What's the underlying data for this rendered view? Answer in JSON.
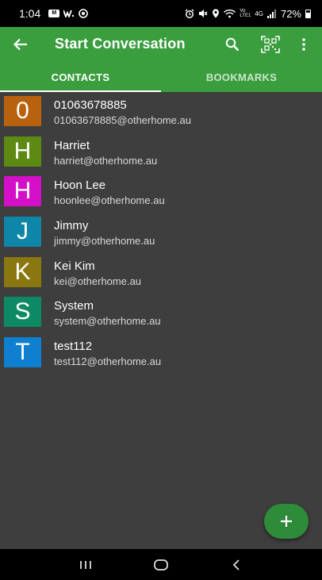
{
  "status_bar": {
    "time": "1:04",
    "left_icons": [
      "gmail-icon",
      "w-app-icon",
      "camera-icon"
    ],
    "right_icons": [
      "alarm-icon",
      "mute-icon",
      "location-icon",
      "wifi-icon",
      "volte-icon",
      "4g-icon",
      "signal-icon",
      "battery-icon"
    ],
    "network_4g": "4G",
    "volte_top": "Vo",
    "volte_bottom": "LTE1",
    "battery_percent": "72%"
  },
  "app_bar": {
    "title": "Start Conversation",
    "color": "#3a9e3f",
    "back_icon": "arrow-back-icon",
    "actions": [
      "search-icon",
      "qr-code-icon",
      "more-vert-icon"
    ]
  },
  "tabs": [
    {
      "label": "CONTACTS",
      "active": true
    },
    {
      "label": "BOOKMARKS",
      "active": false
    }
  ],
  "contacts": [
    {
      "initial": "0",
      "name": "01063678885",
      "email": "01063678885@otherhome.au",
      "color": "#b8620f"
    },
    {
      "initial": "H",
      "name": "Harriet",
      "email": "harriet@otherhome.au",
      "color": "#5c8a12"
    },
    {
      "initial": "H",
      "name": "Hoon Lee",
      "email": "hoonlee@otherhome.au",
      "color": "#d40fc8"
    },
    {
      "initial": "J",
      "name": "Jimmy",
      "email": "jimmy@otherhome.au",
      "color": "#0e86a8"
    },
    {
      "initial": "K",
      "name": "Kei Kim",
      "email": "kei@otherhome.au",
      "color": "#8a7710"
    },
    {
      "initial": "S",
      "name": "System",
      "email": "system@otherhome.au",
      "color": "#0d8a63"
    },
    {
      "initial": "T",
      "name": "test112",
      "email": "test112@otherhome.au",
      "color": "#0f7fd0"
    }
  ],
  "fab": {
    "icon": "add-icon",
    "color": "#2e8b3a"
  },
  "nav_bar": {
    "buttons": [
      "recent-apps-icon",
      "home-icon",
      "back-icon"
    ]
  }
}
